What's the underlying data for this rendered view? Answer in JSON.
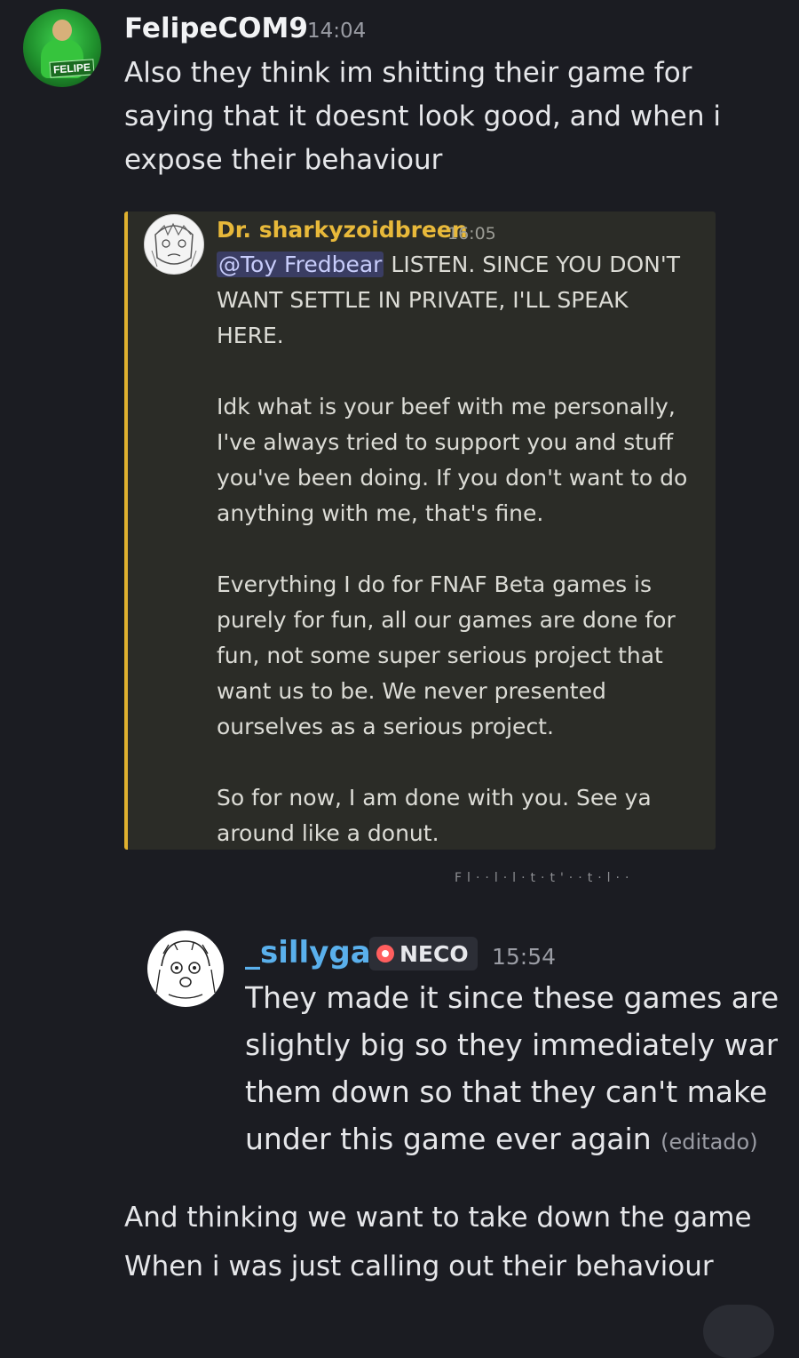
{
  "message1": {
    "author": "FelipeCOM9",
    "timestamp": "14:04",
    "avatar_badge": "FELIPE",
    "text": "Also they think im shitting their game for saying that it doesnt look good, and when i expose their behaviour"
  },
  "embed": {
    "author": "Dr. sharkyzoidbreen",
    "timestamp": "16:05",
    "mention": "@Toy Fredbear",
    "text": " LISTEN. SINCE YOU DON'T WANT SETTLE IN PRIVATE, I'LL SPEAK HERE.\n\nIdk what is your beef with me personally, I've always tried to support you and stuff you've been doing. If you don't want to do anything with me, that's fine.\n\nEverything I do for FNAF Beta games is purely for fun, all our games are done for fun, not some super serious project that want us to be. We never presented ourselves as a serious project.\n\nSo for now, I am done with you. See ya around like a donut.",
    "accent_color": "#e0b12f"
  },
  "cut_text": "Fl··l·l·t·t'··t·l··",
  "reply": {
    "author": "_sillygal",
    "tag": "NECO",
    "timestamp": "15:54",
    "lines": [
      "They made it since these games are g",
      "slightly big so they immediately want",
      "them down so that they can't make a",
      "under this game ever again"
    ],
    "edited_label": "(editado)"
  },
  "message2": {
    "line1": "And thinking we want to take down the game",
    "line2": "When i was just calling out their behaviour"
  }
}
